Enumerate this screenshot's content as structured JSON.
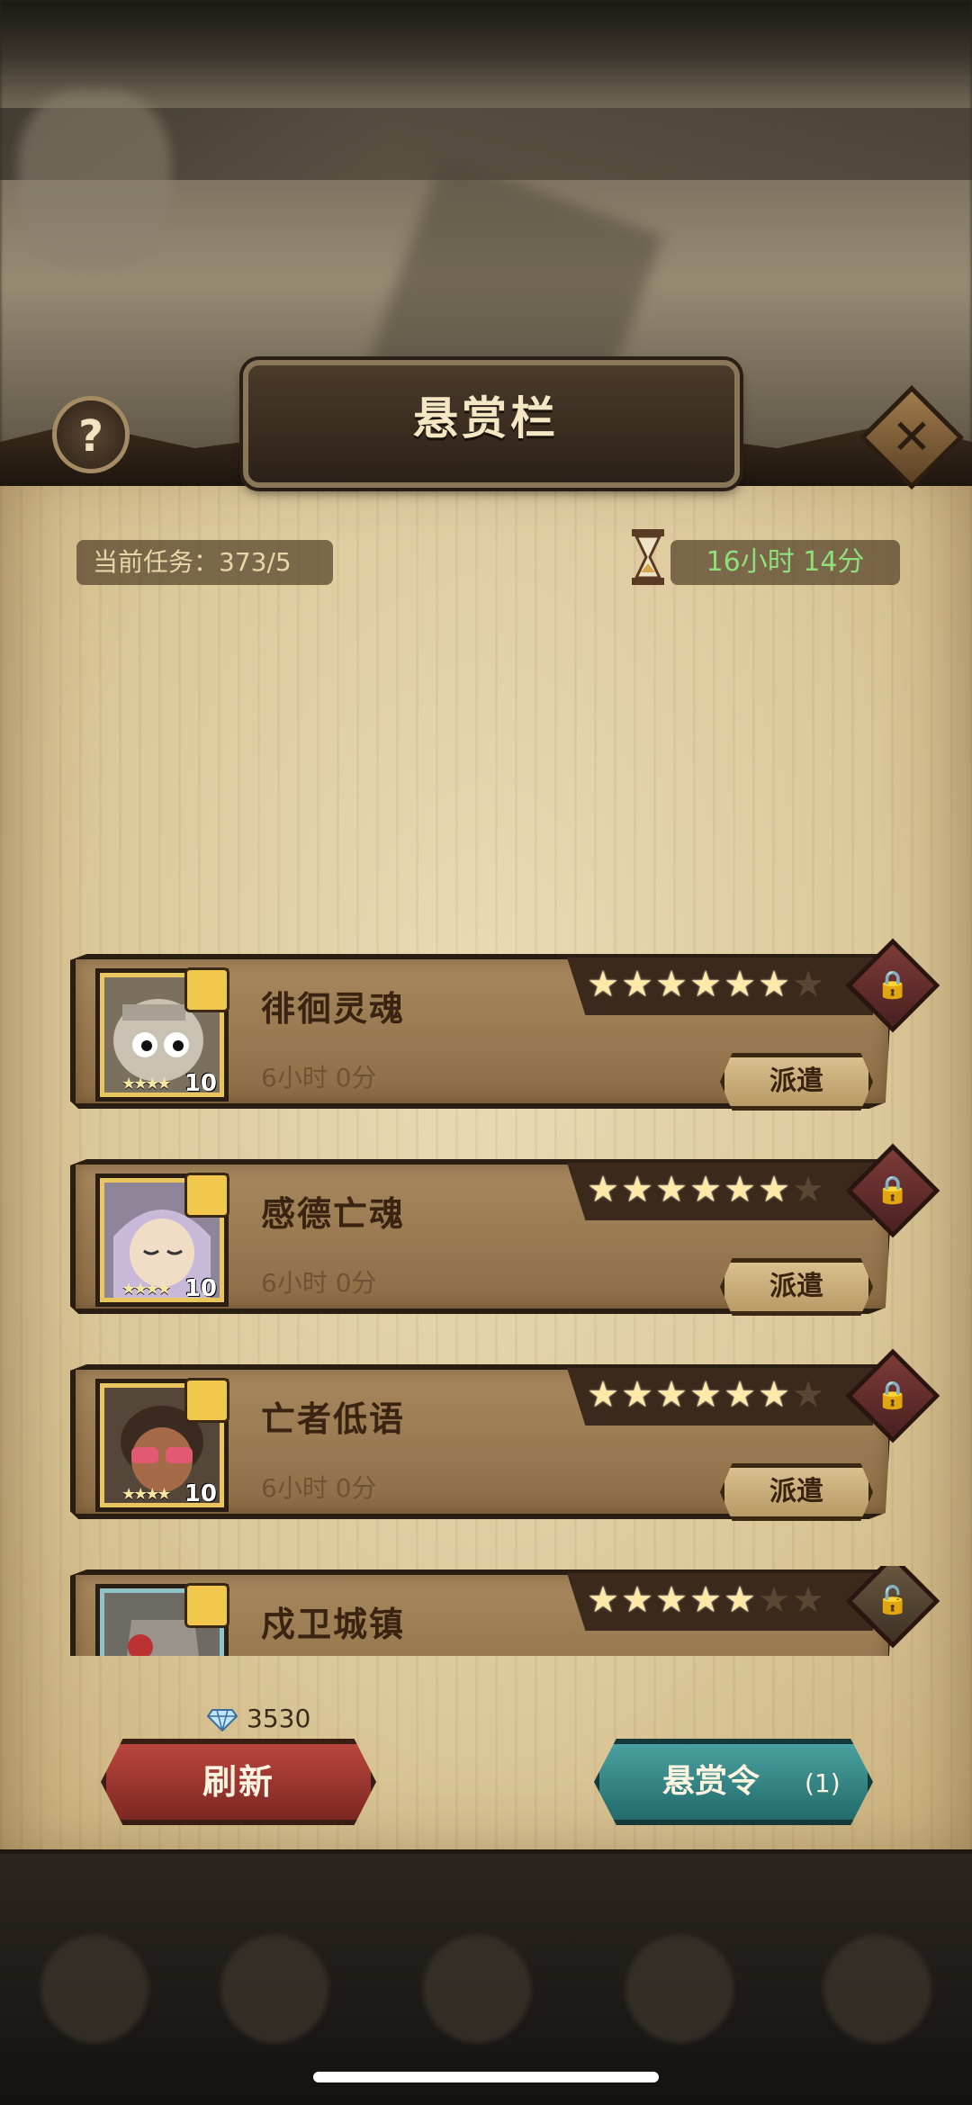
{
  "header": {
    "title": "悬赏栏"
  },
  "info": {
    "current_tasks_label": "当前任务：",
    "current_tasks_value": "373/5",
    "timer": "16小时 14分"
  },
  "icons": {
    "help": "question-mark-icon",
    "close": "close-x-icon",
    "hourglass": "hourglass-icon",
    "gem": "diamond-icon"
  },
  "bounties": [
    {
      "name": "徘徊灵魂",
      "duration": "6小时 0分",
      "stars": 6,
      "max_stars": 7,
      "hero_level": "10",
      "hero_stars": "★★★★",
      "locked": true,
      "dispatch_label": "派遣"
    },
    {
      "name": "感德亡魂",
      "duration": "6小时 0分",
      "stars": 6,
      "max_stars": 7,
      "hero_level": "10",
      "hero_stars": "★★★★",
      "locked": true,
      "dispatch_label": "派遣"
    },
    {
      "name": "亡者低语",
      "duration": "6小时 0分",
      "stars": 6,
      "max_stars": 7,
      "hero_level": "10",
      "hero_stars": "★★★★",
      "locked": true,
      "dispatch_label": "派遣"
    },
    {
      "name": "戍卫城镇",
      "stars": 5,
      "max_stars": 7,
      "locked": false
    }
  ],
  "footer": {
    "gems": "3530",
    "refresh_label": "刷新",
    "bounty_order_label": "悬赏令",
    "bounty_order_count": "(1)"
  },
  "colors": {
    "parchment": "#ddc99b",
    "timer_green": "#8fe07a",
    "refresh_red": "#b9463d",
    "order_teal": "#4aa1a0"
  }
}
